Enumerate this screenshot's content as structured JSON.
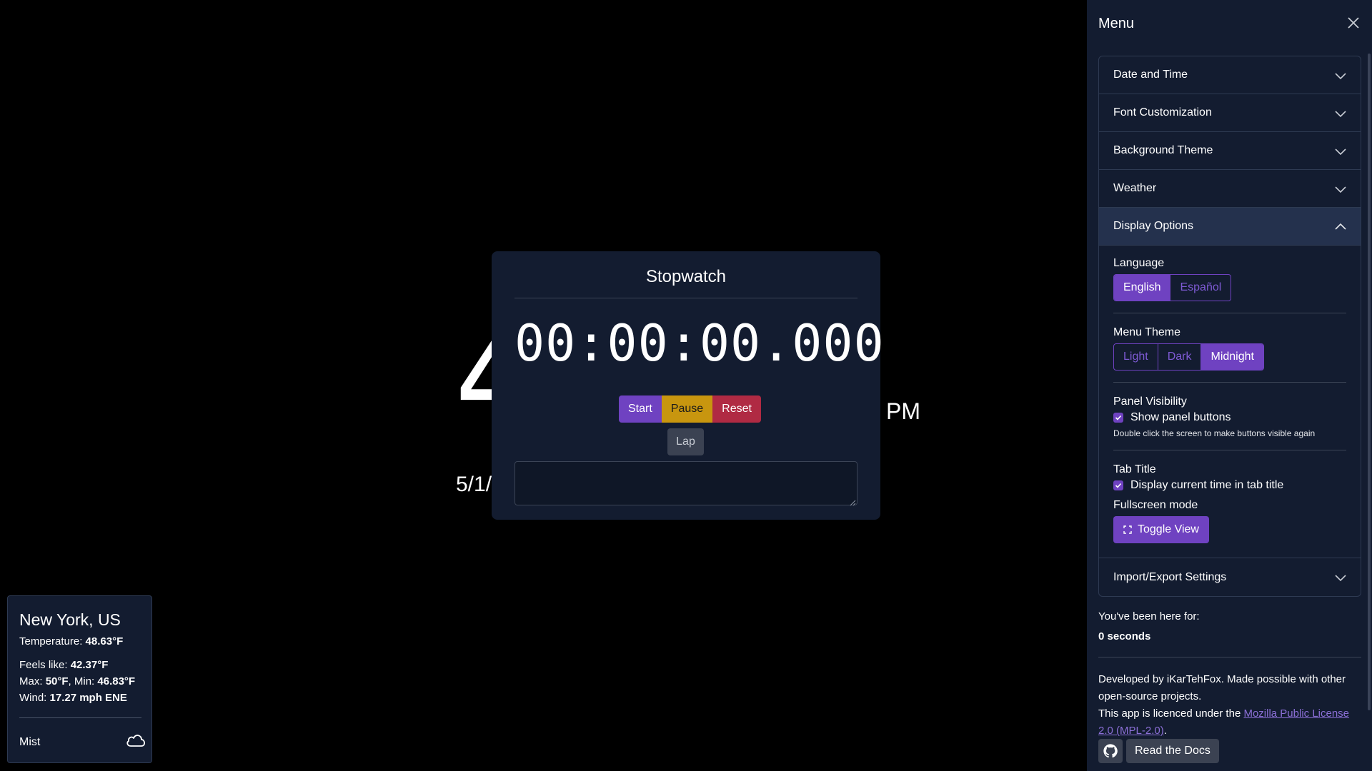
{
  "clock": {
    "time_partial": "4",
    "ampm": "PM",
    "date_partial": "5/1/"
  },
  "stopwatch": {
    "title": "Stopwatch",
    "display": "00:00:00.000",
    "start_label": "Start",
    "pause_label": "Pause",
    "reset_label": "Reset",
    "lap_label": "Lap",
    "notes_value": ""
  },
  "weather": {
    "city": "New York, US",
    "temp_label": "Temperature: ",
    "temp_value": "48.63°F",
    "feels_label": "Feels like: ",
    "feels_value": "42.37°F",
    "max_label": "Max: ",
    "max_value": "50°F",
    "min_label": ", Min: ",
    "min_value": "46.83°F",
    "wind_label": "Wind: ",
    "wind_value": "17.27 mph ENE",
    "condition": "Mist",
    "condition_icon": "cloud-icon"
  },
  "menu": {
    "title": "Menu",
    "sections": {
      "date_time": "Date and Time",
      "font": "Font Customization",
      "background": "Background Theme",
      "weather": "Weather",
      "display": "Display Options",
      "import_export": "Import/Export Settings"
    },
    "display_options": {
      "language_label": "Language",
      "languages": [
        "English",
        "Español"
      ],
      "language_selected": "English",
      "menu_theme_label": "Menu Theme",
      "themes": [
        "Light",
        "Dark",
        "Midnight"
      ],
      "theme_selected": "Midnight",
      "panel_visibility_label": "Panel Visibility",
      "show_panel_buttons_label": "Show panel buttons",
      "show_panel_buttons_checked": true,
      "panel_hint": "Double click the screen to make buttons visible again",
      "tab_title_label": "Tab Title",
      "tab_title_check_label": "Display current time in tab title",
      "tab_title_checked": true,
      "fullscreen_label": "Fullscreen mode",
      "toggle_view_label": "Toggle View"
    },
    "visit_label": "You've been here for:",
    "visit_value": "0 seconds",
    "credits_text": "Developed by iKarTehFox. Made possible with other open-source projects.",
    "license_prefix": "This app is licenced under the ",
    "license_link": "Mozilla Public License 2.0 (MPL-2.0)",
    "license_suffix": ".",
    "docs_label": "Read the Docs"
  },
  "colors": {
    "accent": "#6f42c1",
    "pause": "#c8960f",
    "reset": "#b02a43",
    "panel_bg": "#131c30"
  }
}
